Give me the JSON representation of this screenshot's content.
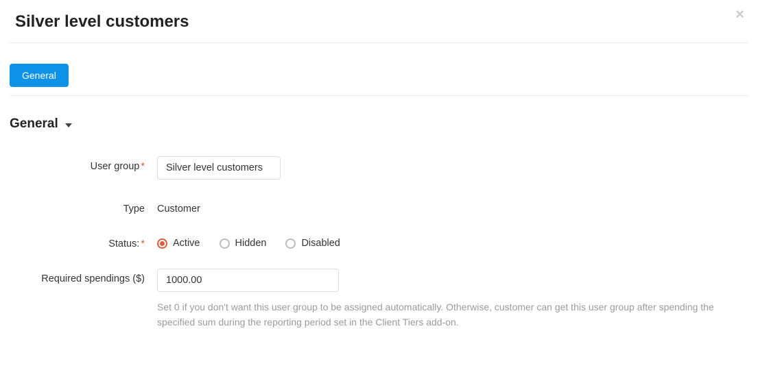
{
  "title": "Silver level customers",
  "close_label": "×",
  "tabs": {
    "general": "General"
  },
  "section": {
    "heading": "General"
  },
  "form": {
    "user_group": {
      "label": "User group",
      "value": "Silver level customers"
    },
    "type": {
      "label": "Type",
      "value": "Customer"
    },
    "status": {
      "label": "Status:",
      "options": {
        "active": "Active",
        "hidden": "Hidden",
        "disabled": "Disabled"
      },
      "selected": "active"
    },
    "spendings": {
      "label": "Required spendings ($)",
      "value": "1000.00",
      "help": "Set 0 if you don't want this user group to be assigned automatically. Otherwise, customer can get this user group after spending the specified sum during the reporting period set in the Client Tiers add-on."
    }
  }
}
